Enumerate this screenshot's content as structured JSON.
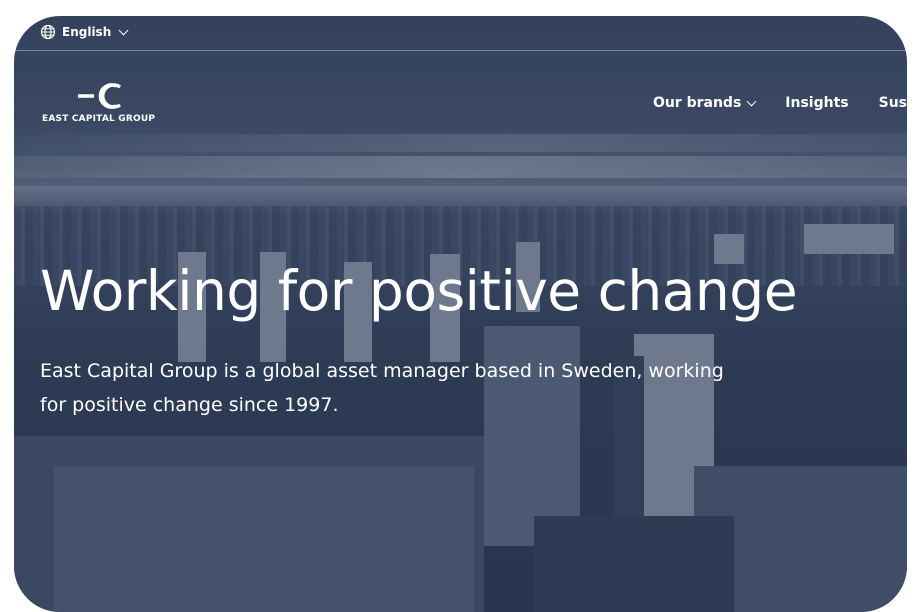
{
  "topbar": {
    "language": "English"
  },
  "logo": {
    "text": "EAST CAPITAL GROUP"
  },
  "nav": {
    "items": [
      {
        "label": "Our brands",
        "has_dropdown": true
      },
      {
        "label": "Insights",
        "has_dropdown": false
      },
      {
        "label": "Sus",
        "has_dropdown": false
      }
    ]
  },
  "hero": {
    "title": "Working for positive change",
    "subtitle": "East Capital Group is a global asset manager based in Sweden, working for positive change since 1997."
  },
  "icons": [
    "globe-icon",
    "chevron-down-icon",
    "logo-mark"
  ],
  "colors": {
    "overlay": "#2d3a54",
    "text": "#ffffff"
  }
}
